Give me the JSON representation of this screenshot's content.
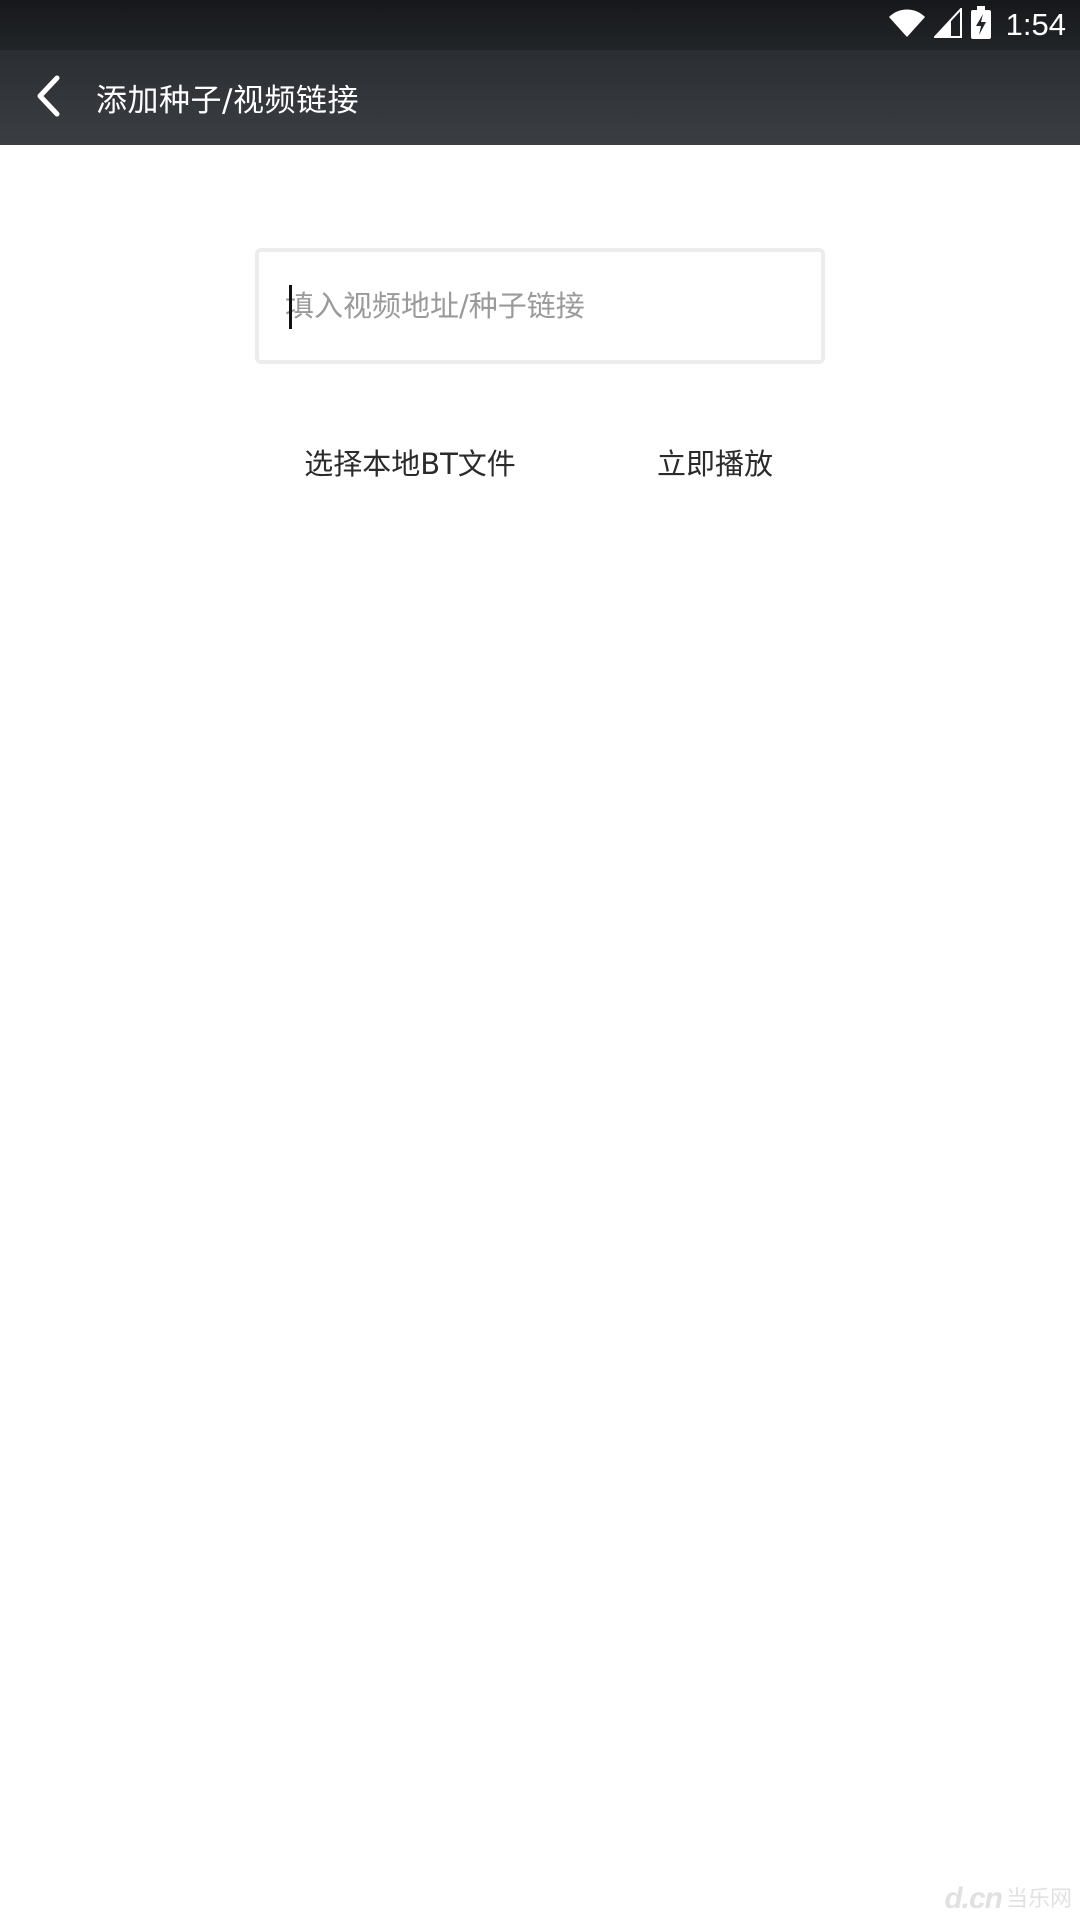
{
  "status_bar": {
    "time": "1:54",
    "icons": [
      "wifi-icon",
      "cell-signal-icon",
      "battery-charging-icon"
    ]
  },
  "app_bar": {
    "title": "添加种子/视频链接",
    "back_icon": "chevron-left-icon"
  },
  "form": {
    "url_input": {
      "placeholder": "填入视频地址/种子链接",
      "value": ""
    },
    "select_local_bt_label": "选择本地BT文件",
    "play_now_label": "立即播放"
  },
  "watermark": {
    "logo_text": "d.cn",
    "logo_cn": "当乐网"
  },
  "colors": {
    "app_bar": "#35383c",
    "status_bar": "#1a1c1f",
    "background": "#ffffff",
    "input_border": "#ececec",
    "placeholder": "#9a9a9a",
    "button_text": "#2b2b2b"
  }
}
